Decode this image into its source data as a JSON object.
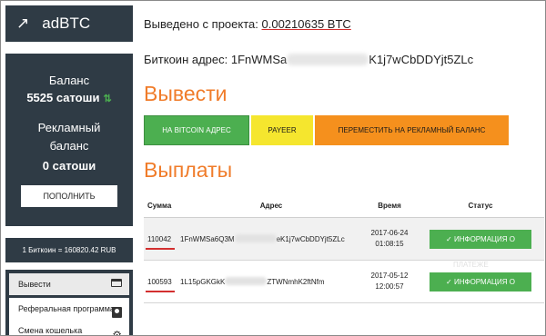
{
  "sidebar": {
    "brand": "adBTC",
    "balance_label": "Баланс",
    "balance_value": "5525 сатоши",
    "ad_balance_label_1": "Рекламный",
    "ad_balance_label_2": "баланс",
    "ad_balance_value": "0 сатоши",
    "topup_label": "ПОПОЛНИТЬ",
    "rate": "1 Биткоин = 160820.42 RUB",
    "menu": [
      {
        "label": "Вывести"
      },
      {
        "label": "Реферальная программа"
      },
      {
        "label": "Смена кошелька"
      }
    ]
  },
  "main": {
    "withdrawn_label": "Выведено с проекта: ",
    "withdrawn_amount": "0.00210635 BTC",
    "address_label": "Биткоин адрес: ",
    "address_start": "1FnWMSa",
    "address_end": "K1j7wCbDDYjt5ZLc",
    "withdraw_heading": "Вывести",
    "buttons": {
      "bitcoin": "НА BITCOIN АДРЕС",
      "payeer": "PAYEER",
      "advertising": "ПЕРЕМЕСТИТЬ НА РЕКЛАМНЫЙ БАЛАНС"
    },
    "payouts_heading": "Выплаты",
    "table": {
      "headers": [
        "Сумма",
        "Адрес",
        "Время",
        "Статус"
      ],
      "rows": [
        {
          "sum": "110042",
          "addr_start": "1FnWMSa6Q3M",
          "addr_end": "eK1j7wCbDDYjt5ZLc",
          "date": "2017-06-24",
          "time": "01:08:15",
          "status": "✓ ИНФОРМАЦИЯ О"
        },
        {
          "sum": "100593",
          "addr_start": "1L15pGKGkK",
          "addr_end": "ZTWNmhK2ftNfm",
          "date": "2017-05-12",
          "time": "12:00:57",
          "status": "✓ ИНФОРМАЦИЯ О"
        }
      ],
      "ghost_text": "ПЛАТЕЖЕ"
    }
  }
}
